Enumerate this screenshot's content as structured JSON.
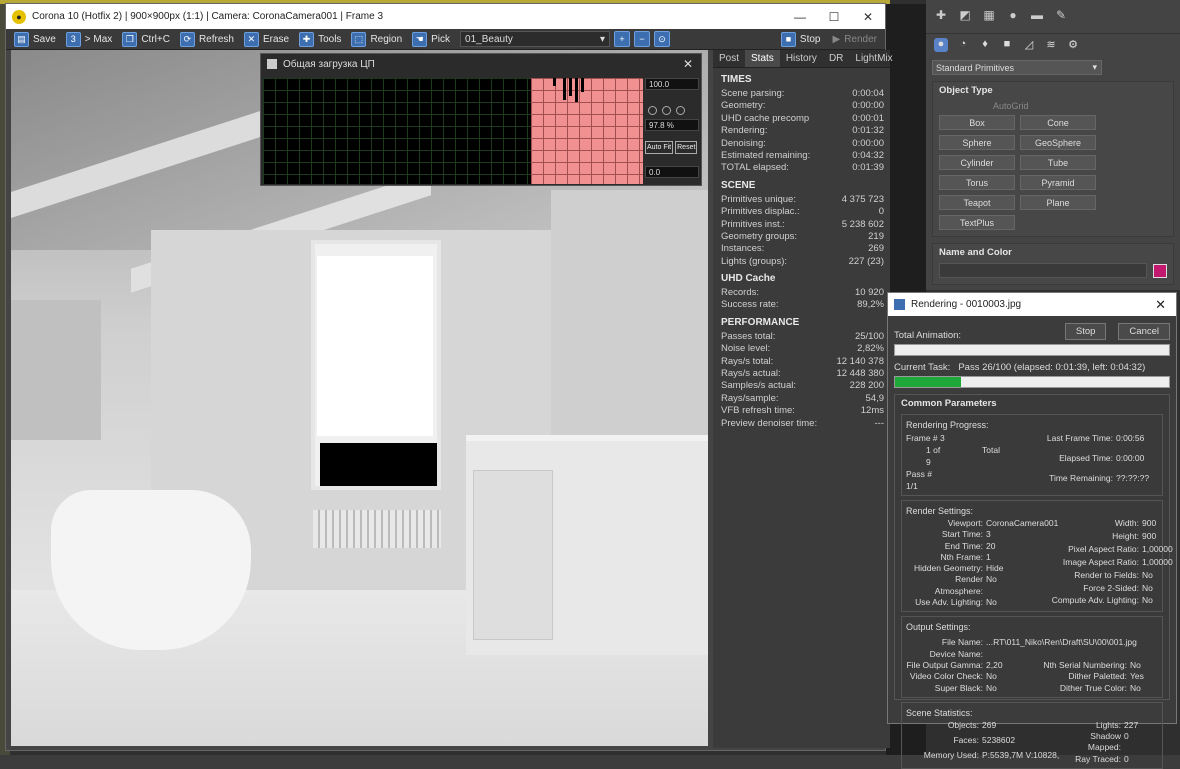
{
  "vfb": {
    "title": "Corona 10 (Hotfix 2) | 900×900px (1:1) | Camera: CoronaCamera001 | Frame 3",
    "toolbar": {
      "save": "Save",
      "to_max": "> Max",
      "ctrl_c": "Ctrl+C",
      "refresh": "Refresh",
      "erase": "Erase",
      "tools": "Tools",
      "region": "Region",
      "pick": "Pick",
      "render_element": "01_Beauty",
      "stop": "Stop",
      "render": "Render"
    }
  },
  "cpu": {
    "title": "Общая загрузка ЦП",
    "top_value": "100.0",
    "pct": "97.8 %",
    "bottom_value": "0.0",
    "autofit": "Auto Fit",
    "reset": "Reset"
  },
  "stats": {
    "tabs": [
      "Post",
      "Stats",
      "History",
      "DR",
      "LightMix"
    ],
    "active_tab": "Stats",
    "sections": [
      {
        "title": "TIMES",
        "rows": [
          [
            "Scene parsing:",
            "0:00:04"
          ],
          [
            "Geometry:",
            "0:00:00"
          ],
          [
            "UHD cache precomp",
            "0:00:01"
          ],
          [
            "Rendering:",
            "0:01:32"
          ],
          [
            "Denoising:",
            "0:00:00"
          ],
          [
            "Estimated remaining:",
            "0:04:32"
          ],
          [
            "TOTAL elapsed:",
            "0:01:39"
          ]
        ]
      },
      {
        "title": "SCENE",
        "rows": [
          [
            "Primitives unique:",
            "4 375 723"
          ],
          [
            "Primitives displac.:",
            "0"
          ],
          [
            "Primitives inst.:",
            "5 238 602"
          ],
          [
            "Geometry groups:",
            "219"
          ],
          [
            "Instances:",
            "269"
          ],
          [
            "Lights (groups):",
            "227 (23)"
          ]
        ]
      },
      {
        "title": "UHD Cache",
        "rows": [
          [
            "Records:",
            "10 920"
          ],
          [
            "Success rate:",
            "89,2%"
          ]
        ]
      },
      {
        "title": "PERFORMANCE",
        "rows": [
          [
            "Passes total:",
            "25/100"
          ],
          [
            "Noise level:",
            "2,82%"
          ],
          [
            "Rays/s total:",
            "12 140 378"
          ],
          [
            "Rays/s actual:",
            "12 448 380"
          ],
          [
            "Samples/s actual:",
            "228 200"
          ],
          [
            "Rays/sample:",
            "54,9"
          ],
          [
            "VFB refresh time:",
            "12ms"
          ],
          [
            "Preview denoiser time:",
            "---"
          ]
        ]
      }
    ]
  },
  "cmd": {
    "dropdown": "Standard Primitives",
    "object_type": "Object Type",
    "autogrid": "AutoGrid",
    "buttons": [
      "Box",
      "Cone",
      "Sphere",
      "GeoSphere",
      "Cylinder",
      "Tube",
      "Torus",
      "Pyramid",
      "Teapot",
      "Plane",
      "TextPlus"
    ],
    "name_color": "Name and Color",
    "color": "#c2186e"
  },
  "render": {
    "title": "Rendering - 0010003.jpg",
    "total_animation": "Total Animation:",
    "stop": "Stop",
    "cancel": "Cancel",
    "current_task_label": "Current Task:",
    "current_task": "Pass 26/100 (elapsed: 0:01:39, left: 0:04:32)",
    "current_progress": 0.24,
    "total_progress": 0.0,
    "common": "Common Parameters",
    "rendering_progress": "Rendering Progress:",
    "frame_label": "Frame #",
    "frame": "3",
    "of": "1 of 9",
    "total": "Total",
    "pass_label": "Pass #",
    "pass": "1/1",
    "last_frame_time_label": "Last Frame Time:",
    "last_frame_time": "0:00:56",
    "elapsed_label": "Elapsed Time:",
    "elapsed": "0:00:00",
    "remaining_label": "Time Remaining:",
    "remaining": "??:??:??",
    "render_settings": "Render Settings:",
    "rs_left": [
      [
        "Viewport:",
        "CoronaCamera001"
      ],
      [
        "Start Time:",
        "3"
      ],
      [
        "End Time:",
        "20"
      ],
      [
        "Nth Frame:",
        "1"
      ],
      [
        "Hidden Geometry:",
        "Hide"
      ],
      [
        "Render Atmosphere:",
        "No"
      ],
      [
        "Use Adv. Lighting:",
        "No"
      ]
    ],
    "rs_right": [
      [
        "Width:",
        "900"
      ],
      [
        "Height:",
        "900"
      ],
      [
        "Pixel Aspect Ratio:",
        "1,00000"
      ],
      [
        "Image Aspect Ratio:",
        "1,00000"
      ],
      [
        "Render to Fields:",
        "No"
      ],
      [
        "Force 2-Sided:",
        "No"
      ],
      [
        "Compute Adv. Lighting:",
        "No"
      ]
    ],
    "output_settings": "Output Settings:",
    "file_name_label": "File Name:",
    "file_name": "...RT\\011_Niko\\Ren\\Draft\\SU\\00\\001.jpg",
    "device_label": "Device Name:",
    "os_left": [
      [
        "File Output Gamma:",
        "2,20"
      ],
      [
        "Video Color Check:",
        "No"
      ],
      [
        "Super Black:",
        "No"
      ]
    ],
    "os_right": [
      [
        "Nth Serial Numbering:",
        "No"
      ],
      [
        "Dither Paletted:",
        "Yes"
      ],
      [
        "Dither True Color:",
        "No"
      ]
    ],
    "scene_stats": "Scene Statistics:",
    "ss_left": [
      [
        "Objects:",
        "269"
      ],
      [
        "Faces:",
        "5238602"
      ],
      [
        "Memory Used:",
        "P:5539,7M V:10828,"
      ]
    ],
    "ss_right": [
      [
        "Lights:",
        "227"
      ],
      [
        "Shadow Mapped:",
        "0"
      ],
      [
        "Ray Traced:",
        "0"
      ]
    ]
  }
}
